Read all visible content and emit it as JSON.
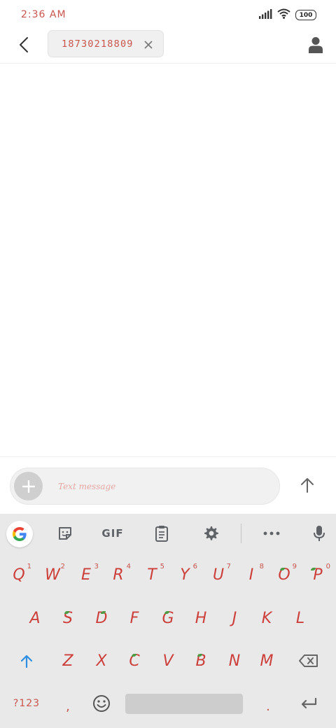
{
  "status_bar": {
    "time": "2:36 AM",
    "battery": "100"
  },
  "header": {
    "recipient": "18730218809"
  },
  "compose": {
    "placeholder": "Text message"
  },
  "keyboard": {
    "toolbar": {
      "gif_label": "GIF"
    },
    "row1": [
      {
        "letter": "Q",
        "hint": "1"
      },
      {
        "letter": "W",
        "hint": "2"
      },
      {
        "letter": "E",
        "hint": "3"
      },
      {
        "letter": "R",
        "hint": "4"
      },
      {
        "letter": "T",
        "hint": "5"
      },
      {
        "letter": "Y",
        "hint": "6"
      },
      {
        "letter": "U",
        "hint": "7"
      },
      {
        "letter": "I",
        "hint": "8"
      },
      {
        "letter": "O",
        "hint": "9"
      },
      {
        "letter": "P",
        "hint": "0"
      }
    ],
    "row2": [
      "A",
      "S",
      "D",
      "F",
      "G",
      "H",
      "J",
      "K",
      "L"
    ],
    "row3": [
      "Z",
      "X",
      "C",
      "V",
      "B",
      "N",
      "M"
    ],
    "symbols_label": "?123",
    "comma": ",",
    "period": "."
  },
  "colors": {
    "accent_red": "#cc3f3a",
    "shift_blue": "#2f8fe3",
    "keyboard_bg": "#e9e9e9"
  }
}
